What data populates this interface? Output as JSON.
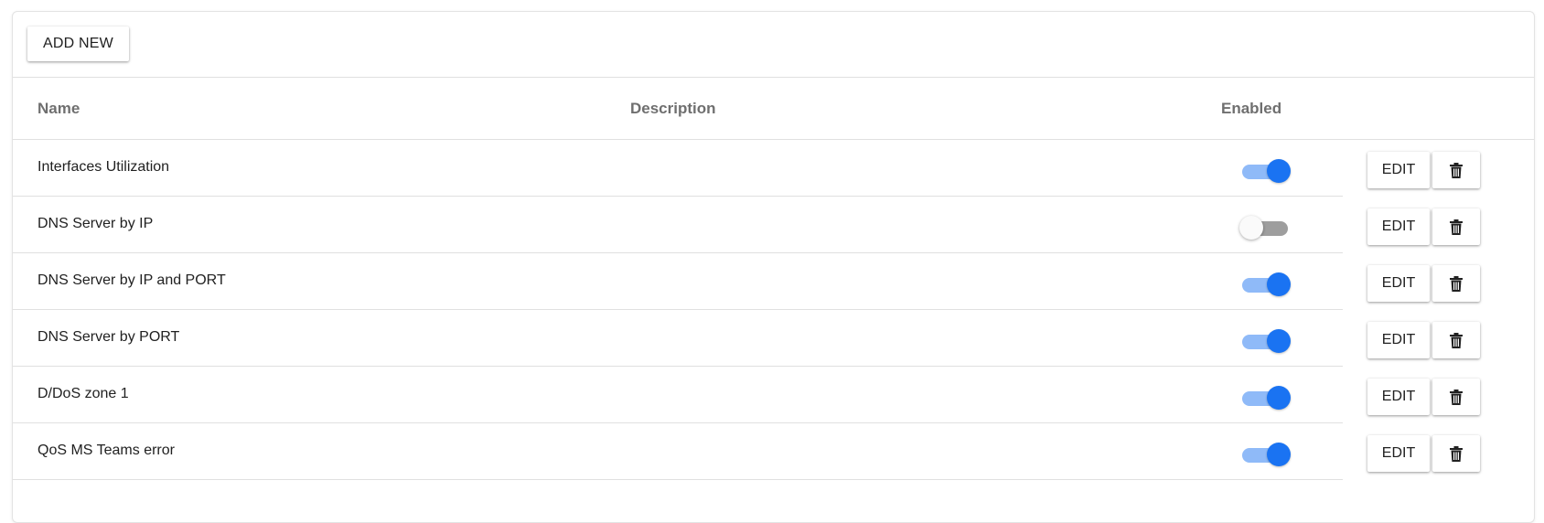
{
  "toolbar": {
    "add_new_label": "ADD NEW"
  },
  "table": {
    "headers": {
      "name": "Name",
      "description": "Description",
      "enabled": "Enabled"
    },
    "edit_label": "EDIT",
    "rows": [
      {
        "name": "Interfaces Utilization",
        "description": "",
        "enabled": true
      },
      {
        "name": "DNS Server by IP",
        "description": "",
        "enabled": false
      },
      {
        "name": "DNS Server by IP and PORT",
        "description": "",
        "enabled": true
      },
      {
        "name": "DNS Server by PORT",
        "description": "",
        "enabled": true
      },
      {
        "name": "D/DoS zone 1",
        "description": "",
        "enabled": true
      },
      {
        "name": "QoS MS Teams error",
        "description": "",
        "enabled": true
      }
    ]
  },
  "icons": {
    "delete": "trash-icon"
  },
  "colors": {
    "accent": "#1a73f2",
    "accent_track": "#8fbaf8",
    "off_track": "#9e9e9e"
  }
}
